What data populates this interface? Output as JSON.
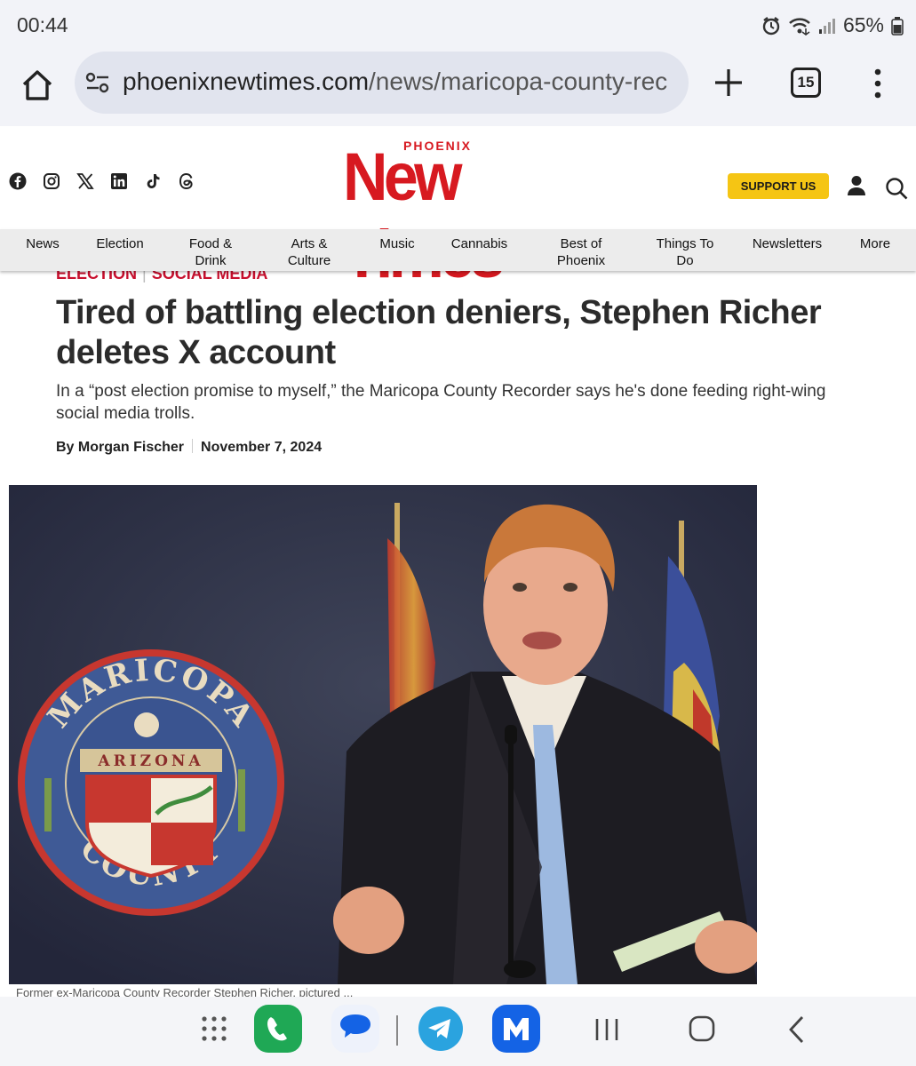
{
  "status": {
    "time": "00:44",
    "battery": "65%"
  },
  "browser": {
    "url_domain": "phoenixnewtimes.com",
    "url_path": "/news/maricopa-county-rec",
    "tab_count": "15"
  },
  "site": {
    "logo_small": "PHOENIX",
    "logo_big": "New Times",
    "support_label": "SUPPORT US",
    "socials": [
      "facebook-icon",
      "instagram-icon",
      "x-icon",
      "linkedin-icon",
      "tiktok-icon",
      "threads-icon"
    ]
  },
  "nav": {
    "items": [
      {
        "label": "News"
      },
      {
        "label": "Election"
      },
      {
        "label": "Food & Drink"
      },
      {
        "label": "Arts & Culture"
      },
      {
        "label": "Music"
      },
      {
        "label": "Cannabis"
      },
      {
        "label": "Best of Phoenix"
      },
      {
        "label": "Things To Do"
      },
      {
        "label": "Newsletters"
      },
      {
        "label": "More"
      }
    ]
  },
  "article": {
    "tag1": "ELECTION",
    "tag2": "SOCIAL MEDIA",
    "headline": "Tired of battling election deniers, Stephen Richer deletes X account",
    "dek": "In a “post election promise to myself,” the Maricopa County Recorder says he's done feeding right-wing social media trolls.",
    "author": "By Morgan Fischer",
    "date": "November 7, 2024",
    "seal_top": "MARICOPA",
    "seal_middle": "ARIZONA",
    "seal_bottom": "COUNTY",
    "caption": "Former ex-Maricopa County Recorder Stephen Richer, pictured ..."
  },
  "colors": {
    "brand_red": "#d71920",
    "tag_red": "#c8102e",
    "support_yellow": "#f5c514",
    "whatsapp_green": "#1fa855",
    "telegram_blue": "#2aa3df",
    "app_blue": "#1463e5"
  },
  "bottom_apps": [
    "apps-grid-icon",
    "phone-app-icon",
    "messages-app-icon",
    "telegram-app-icon",
    "m-app-icon",
    "recents-icon",
    "home-icon",
    "back-icon"
  ]
}
